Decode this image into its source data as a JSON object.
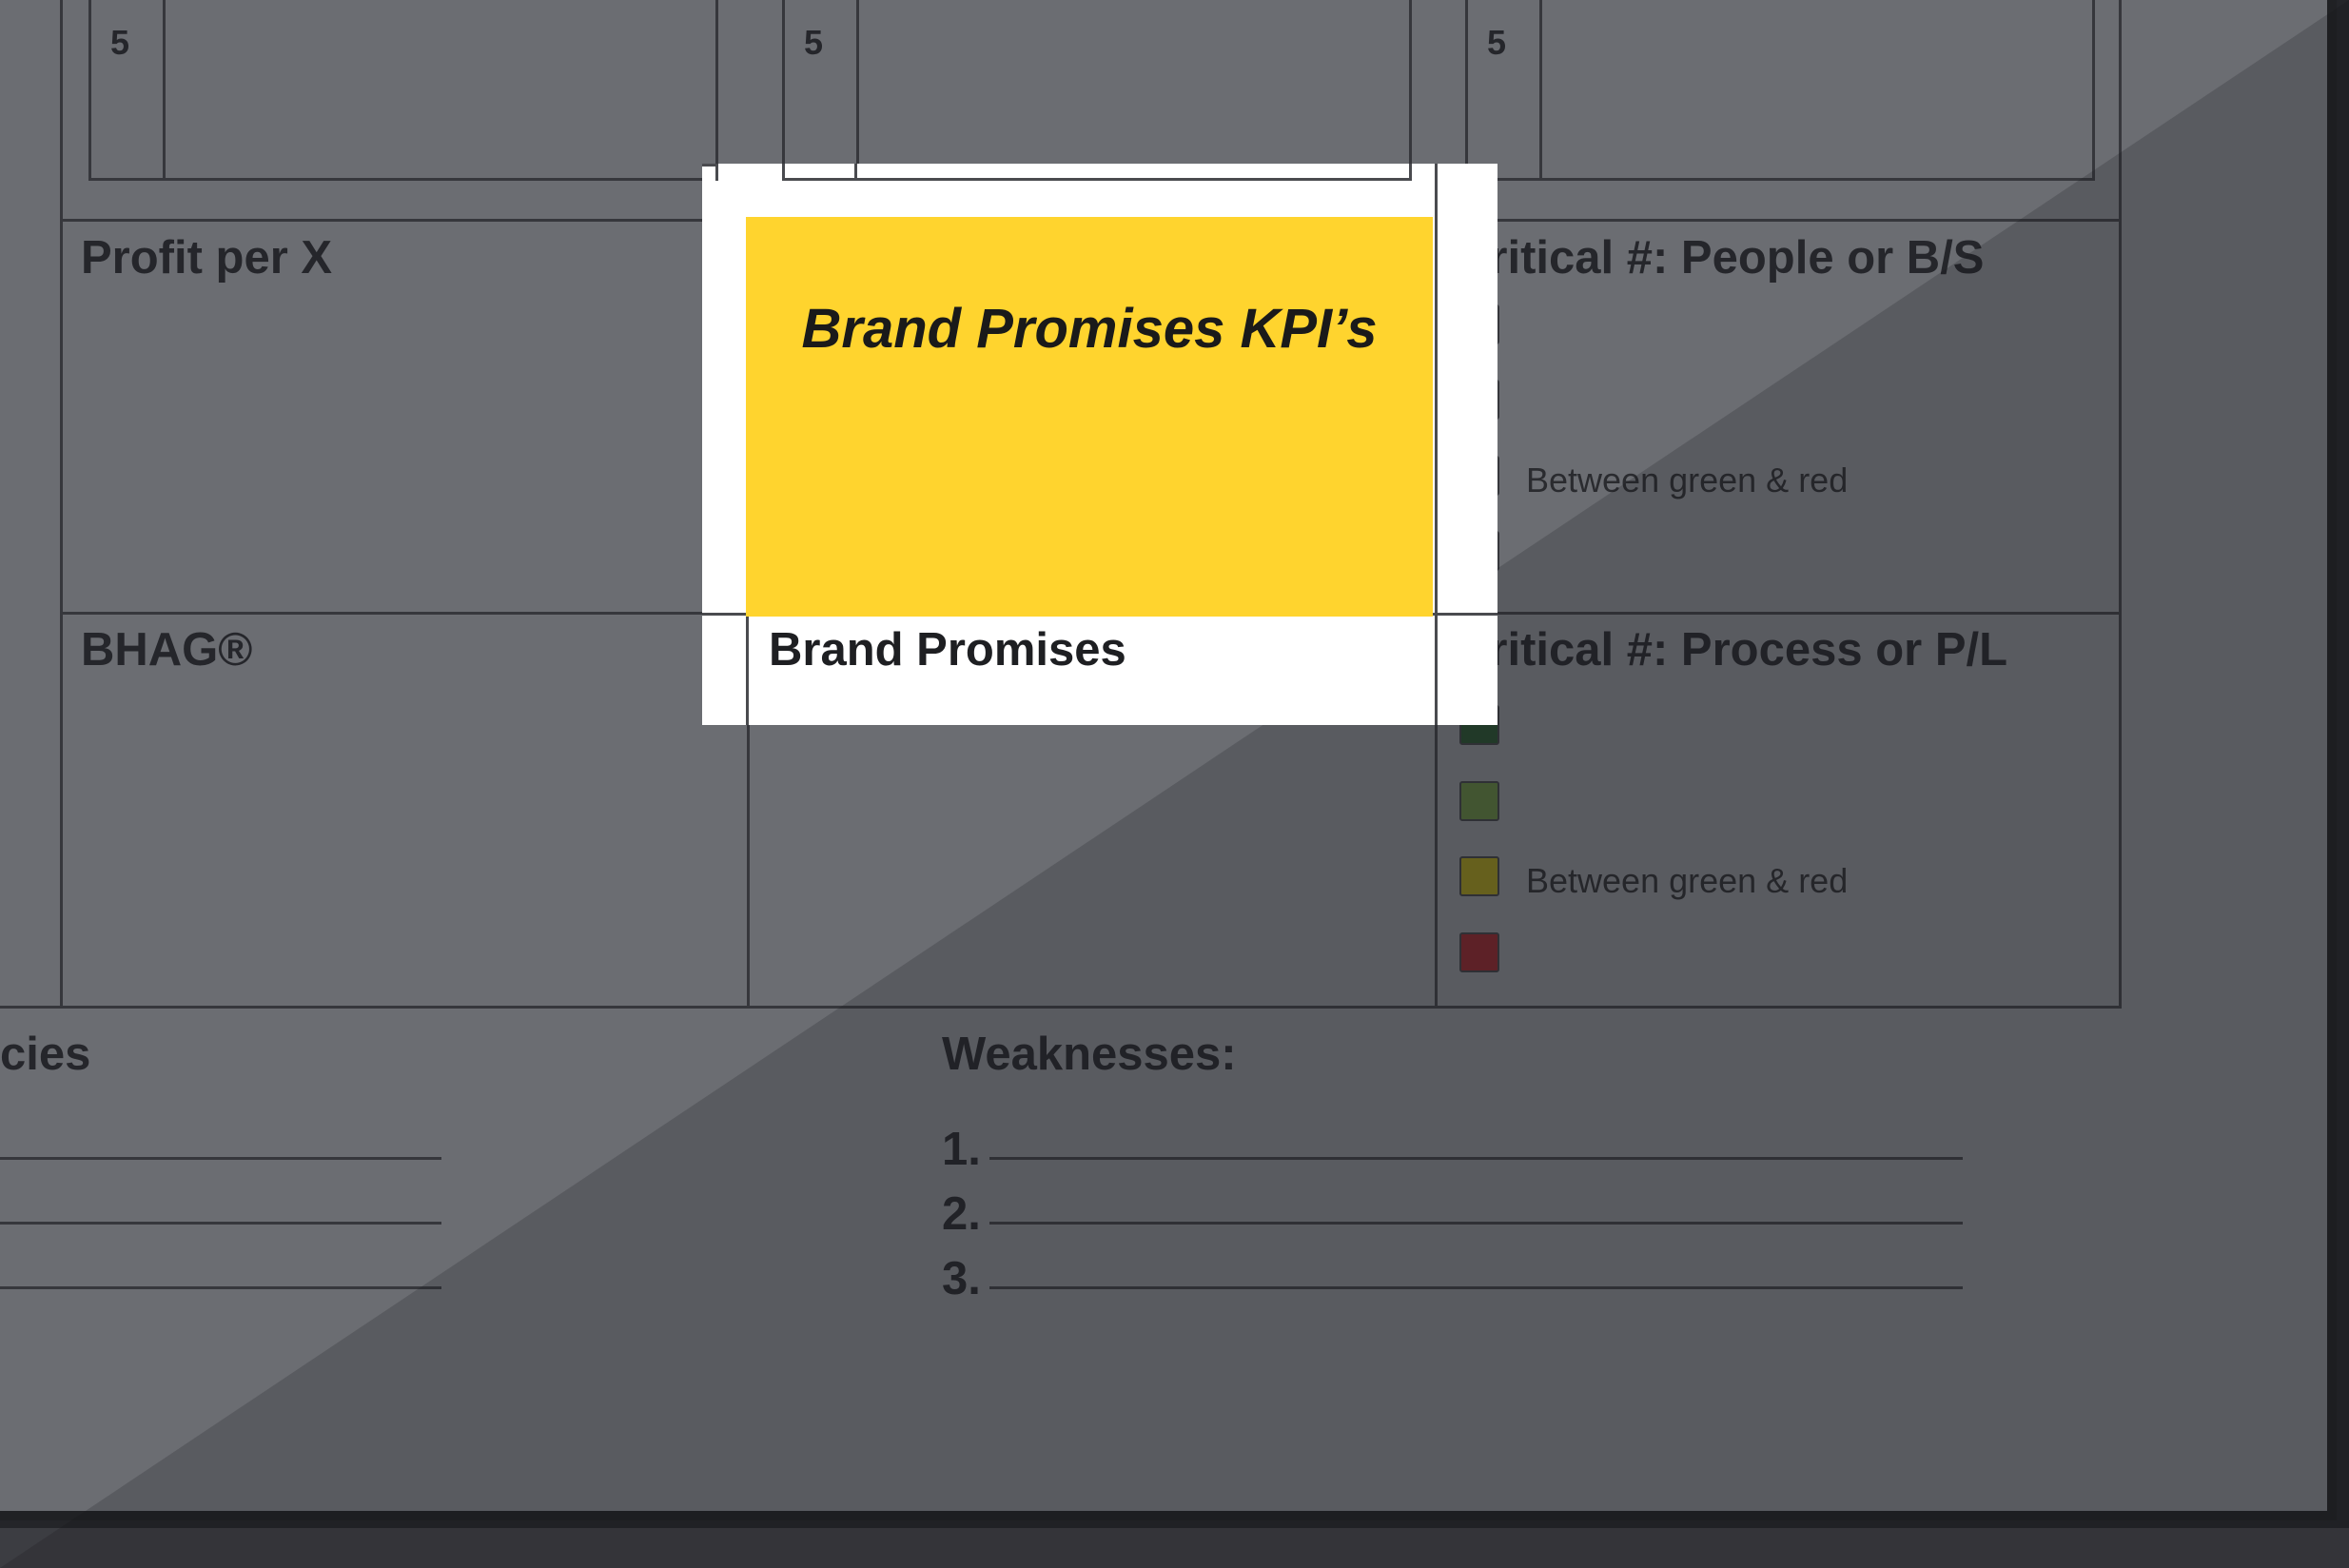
{
  "top_row": {
    "numbers": [
      "5",
      "5",
      "5"
    ]
  },
  "grid": {
    "profit_title": "Profit per X",
    "bhag_title": "BHAG®",
    "brand_promises_title": "Brand Promises",
    "critical_people_title": "Critical #: People or B/S",
    "critical_process_title": "Critical #: Process or P/L",
    "legend_between": "Between green & red"
  },
  "status_colors": [
    "#1e6b26",
    "#8ac442",
    "#ffe600",
    "#e21b23"
  ],
  "bottom": {
    "left_partial_heading": "cies",
    "weaknesses_heading": "Weaknesses:",
    "weakness_items": [
      "1.",
      "2.",
      "3."
    ]
  },
  "highlight": {
    "kpi_box_color": "#ffd42e",
    "kpi_title": "Brand Promises KPI’s"
  }
}
